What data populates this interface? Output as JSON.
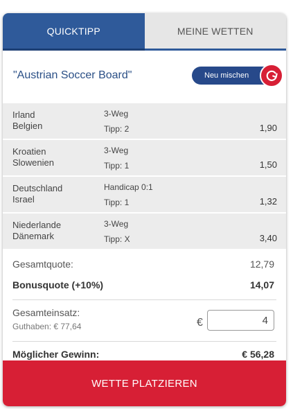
{
  "tabs": {
    "quicktipp": "QUICKTIPP",
    "meine_wetten": "MEINE WETTEN"
  },
  "board": {
    "title": "\"Austrian Soccer Board\"",
    "shuffle_label": "Neu mischen",
    "shuffle_icon": "refresh-icon"
  },
  "bets": [
    {
      "team1": "Irland",
      "team2": "Belgien",
      "market": "3-Weg",
      "tip": "Tipp: 2",
      "odds": "1,90"
    },
    {
      "team1": "Kroatien",
      "team2": "Slowenien",
      "market": "3-Weg",
      "tip": "Tipp: 1",
      "odds": "1,50"
    },
    {
      "team1": "Deutschland",
      "team2": "Israel",
      "market": "Handicap 0:1",
      "tip": "Tipp: 1",
      "odds": "1,32"
    },
    {
      "team1": "Niederlande",
      "team2": "Dänemark",
      "market": "3-Weg",
      "tip": "Tipp: X",
      "odds": "3,40"
    }
  ],
  "summary": {
    "total_odds_label": "Gesamtquote:",
    "total_odds_value": "12,79",
    "bonus_label": "Bonusquote (+10%)",
    "bonus_value": "14,07",
    "stake_label": "Gesamteinsatz:",
    "balance_label": "Guthaben: € 77,64",
    "currency": "€",
    "stake_value": "4",
    "win_label": "Möglicher Gewinn:",
    "win_value": "€ 56,28"
  },
  "place_button": "WETTE PLATZIEREN",
  "colors": {
    "primary_blue": "#2f5a9a",
    "accent_red": "#d71f35",
    "row_bg": "#ececec"
  }
}
